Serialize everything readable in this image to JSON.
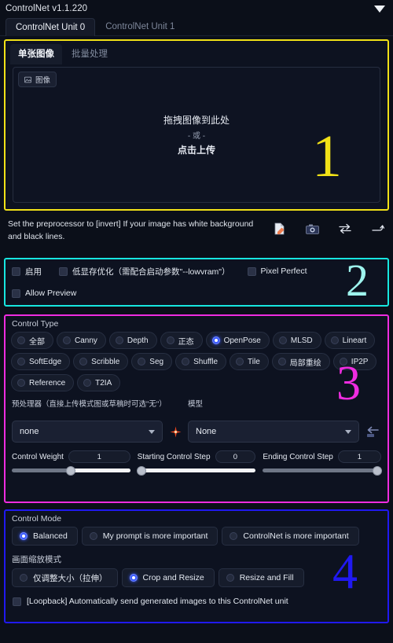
{
  "window": {
    "title": "ControlNet v1.1.220",
    "collapse_icon": "chevron-down-icon"
  },
  "unit_tabs": [
    {
      "label": "ControlNet Unit 0",
      "active": true
    },
    {
      "label": "ControlNet Unit 1",
      "active": false
    }
  ],
  "section1": {
    "accent": "#f1e117",
    "badge_number": "1",
    "tabs": [
      {
        "label": "单张图像",
        "active": true
      },
      {
        "label": "批量处理",
        "active": false
      }
    ],
    "image_badge": "图像",
    "dropzone": {
      "line1": "拖拽图像到此处",
      "line2": "- 或 -",
      "line3": "点击上传"
    }
  },
  "hint": {
    "text": "Set the preprocessor to [invert] If your image has white background and black lines.",
    "icons": [
      "edit-document-icon",
      "camera-icon",
      "swap-arrows-icon",
      "send-arrow-icon"
    ]
  },
  "section2": {
    "accent": "#17e6e0",
    "badge_number": "2",
    "checkboxes": [
      {
        "label": "启用",
        "checked": false
      },
      {
        "label": "低显存优化（需配合启动参数\"--lowvram\"）",
        "checked": false
      },
      {
        "label": "Pixel Perfect",
        "checked": false
      },
      {
        "label": "Allow Preview",
        "checked": false
      }
    ]
  },
  "section3": {
    "accent": "#ef2ce0",
    "badge_number": "3",
    "control_type_label": "Control Type",
    "control_types": [
      {
        "label": "全部",
        "selected": false
      },
      {
        "label": "Canny",
        "selected": false
      },
      {
        "label": "Depth",
        "selected": false
      },
      {
        "label": "正态",
        "selected": false
      },
      {
        "label": "OpenPose",
        "selected": true
      },
      {
        "label": "MLSD",
        "selected": false
      },
      {
        "label": "Lineart",
        "selected": false
      },
      {
        "label": "SoftEdge",
        "selected": false
      },
      {
        "label": "Scribble",
        "selected": false
      },
      {
        "label": "Seg",
        "selected": false
      },
      {
        "label": "Shuffle",
        "selected": false
      },
      {
        "label": "Tile",
        "selected": false
      },
      {
        "label": "局部重绘",
        "selected": false
      },
      {
        "label": "IP2P",
        "selected": false
      },
      {
        "label": "Reference",
        "selected": false
      },
      {
        "label": "T2IA",
        "selected": false
      }
    ],
    "preprocessor": {
      "label": "预处理器（直接上传模式图或草稿时可选\"无\"）",
      "value": "none"
    },
    "model": {
      "label": "模型",
      "value": "None"
    },
    "run_icon": "spark-icon",
    "refresh_models_icon": "left-arrow-icon",
    "sliders": [
      {
        "name": "Control Weight",
        "value": "1",
        "percent": 50
      },
      {
        "name": "Starting Control Step",
        "value": "0",
        "percent": 0
      },
      {
        "name": "Ending Control Step",
        "value": "1",
        "percent": 100
      }
    ]
  },
  "section4": {
    "accent": "#2019f0",
    "badge_number": "4",
    "control_mode_label": "Control Mode",
    "control_modes": [
      {
        "label": "Balanced",
        "selected": true
      },
      {
        "label": "My prompt is more important",
        "selected": false
      },
      {
        "label": "ControlNet is more important",
        "selected": false
      }
    ],
    "resize_mode_label": "画面缩放模式",
    "resize_modes": [
      {
        "label": "仅调整大小（拉伸）",
        "selected": false
      },
      {
        "label": "Crop and Resize",
        "selected": true
      },
      {
        "label": "Resize and Fill",
        "selected": false
      }
    ],
    "loopback": {
      "label": "[Loopback] Automatically send generated images to this ControlNet unit",
      "checked": false
    }
  }
}
